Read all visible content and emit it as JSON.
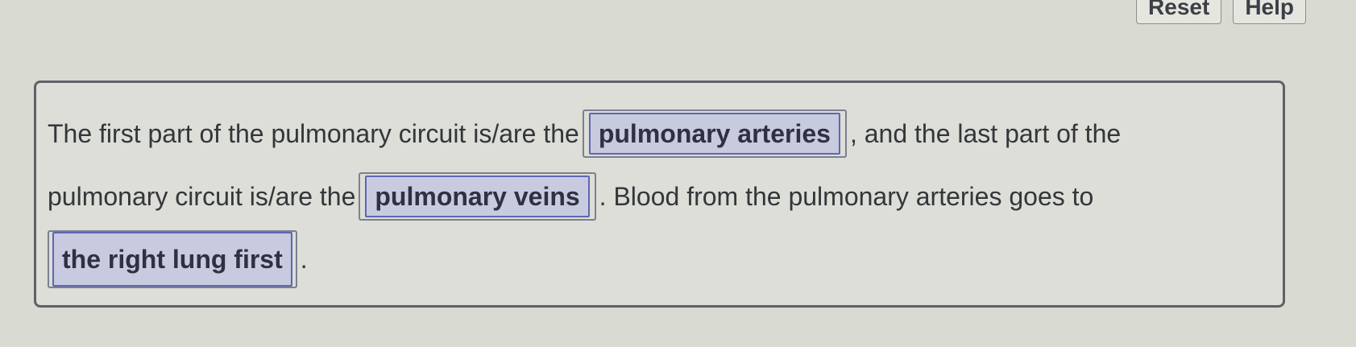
{
  "toolbar": {
    "reset_label": "Reset",
    "help_label": "Help"
  },
  "question": {
    "part1": "The first part of the pulmonary circuit is/are the",
    "answer1": "pulmonary arteries",
    "part2": ", and the last part of the",
    "part3": "pulmonary circuit is/are the",
    "answer2": "pulmonary veins",
    "part4": ". Blood from the pulmonary arteries goes to",
    "answer3": "the right lung first",
    "part5": "."
  }
}
